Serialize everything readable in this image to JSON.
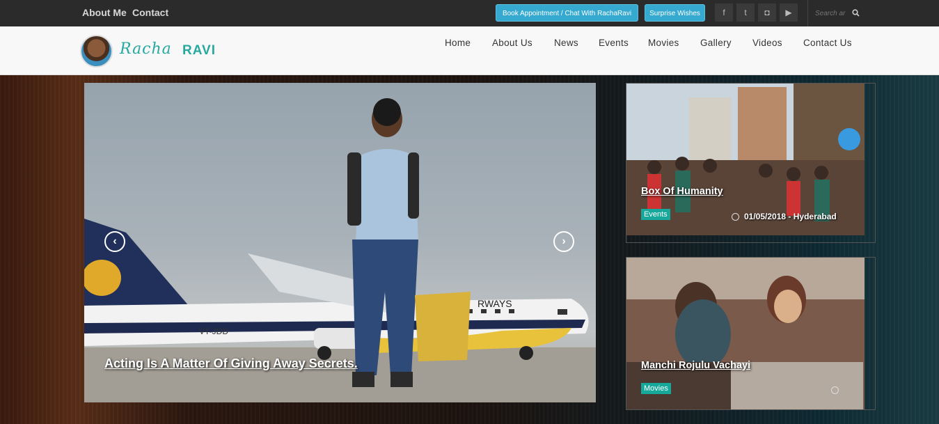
{
  "topbar": {
    "links": [
      "About Me",
      "Contact"
    ],
    "book_button": "Book Appointment / Chat With RachaRavi",
    "wishes_button": "Surprise Wishes",
    "social": [
      "f",
      "t",
      "◘",
      "▶"
    ],
    "search_placeholder": "Search ar"
  },
  "header": {
    "logo_script": "Racha",
    "logo_bold": "RAVI",
    "nav": [
      "Home",
      "About Us",
      "News",
      "Events",
      "Movies",
      "Gallery",
      "Videos",
      "Contact Us"
    ]
  },
  "slider": {
    "caption": "Acting Is A Matter Of Giving Away Secrets.",
    "prev": "‹",
    "next": "›",
    "plane_reg": "VT-JDD",
    "plane_text": "RWAYS"
  },
  "cards": [
    {
      "title": "Box Of Humanity",
      "category": "Events",
      "meta": "01/05/2018 - Hyderabad"
    },
    {
      "title": "Manchi Rojulu Vachayi",
      "category": "Movies",
      "meta": ""
    }
  ],
  "colors": {
    "accent": "#27a9a0",
    "button": "#35a9cf",
    "badge": "#16a89a"
  }
}
